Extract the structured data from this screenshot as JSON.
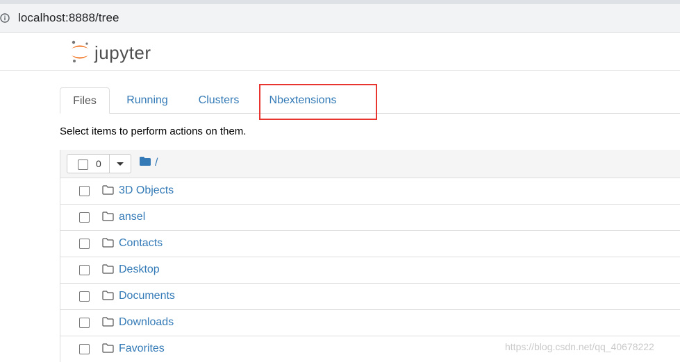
{
  "browser": {
    "url": "localhost:8888/tree"
  },
  "header": {
    "logo_text": "jupyter"
  },
  "tabs": [
    {
      "label": "Files",
      "active": true
    },
    {
      "label": "Running",
      "active": false
    },
    {
      "label": "Clusters",
      "active": false
    },
    {
      "label": "Nbextensions",
      "active": false
    }
  ],
  "hint": "Select items to perform actions on them.",
  "list_header": {
    "selected_count": "0",
    "breadcrumb": "/"
  },
  "items": [
    {
      "name": "3D Objects"
    },
    {
      "name": "ansel"
    },
    {
      "name": "Contacts"
    },
    {
      "name": "Desktop"
    },
    {
      "name": "Documents"
    },
    {
      "name": "Downloads"
    },
    {
      "name": "Favorites"
    }
  ],
  "watermark": "https://blog.csdn.net/qq_40678222",
  "colors": {
    "link": "#337ab7",
    "highlight": "#e8352f",
    "logo_orange": "#f37726"
  }
}
